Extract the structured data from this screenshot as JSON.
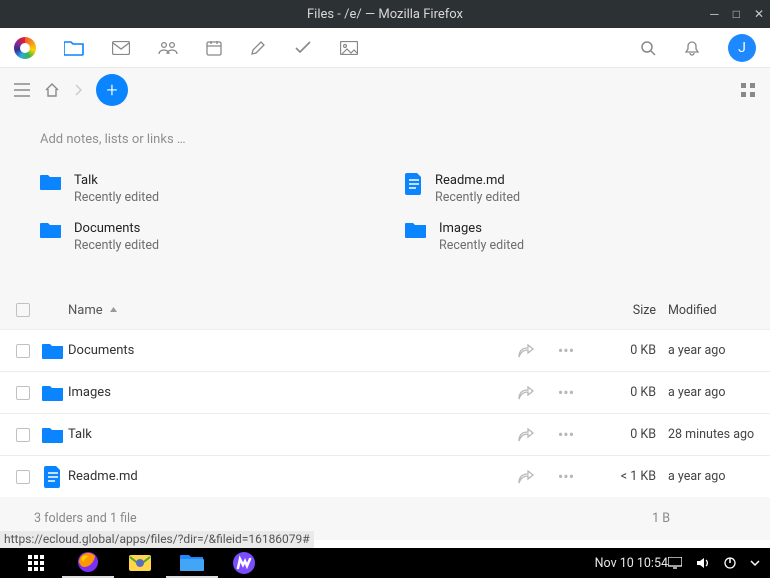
{
  "window": {
    "title": "Files - /e/ — Mozilla Firefox"
  },
  "avatar_letter": "J",
  "notes_hint": "Add notes, lists or links …",
  "recent": [
    {
      "name": "Talk",
      "sub": "Recently edited",
      "type": "folder"
    },
    {
      "name": "Readme.md",
      "sub": "Recently edited",
      "type": "file"
    },
    {
      "name": "Documents",
      "sub": "Recently edited",
      "type": "folder"
    },
    {
      "name": "Images",
      "sub": "Recently edited",
      "type": "folder"
    }
  ],
  "table": {
    "columns": {
      "name": "Name",
      "size": "Size",
      "modified": "Modified"
    },
    "rows": [
      {
        "name": "Documents",
        "type": "folder",
        "size": "0 KB",
        "modified": "a year ago"
      },
      {
        "name": "Images",
        "type": "folder",
        "size": "0 KB",
        "modified": "a year ago"
      },
      {
        "name": "Talk",
        "type": "folder",
        "size": "0 KB",
        "modified": "28 minutes ago"
      },
      {
        "name": "Readme.md",
        "type": "file",
        "size": "< 1 KB",
        "modified": "a year ago"
      }
    ]
  },
  "summary": {
    "text": "3 folders and 1 file",
    "size": "1 B"
  },
  "status_url": "https://ecloud.global/apps/files/?dir=/&fileid=16186079#",
  "taskbar": {
    "clock": "Nov 10  10:54"
  }
}
